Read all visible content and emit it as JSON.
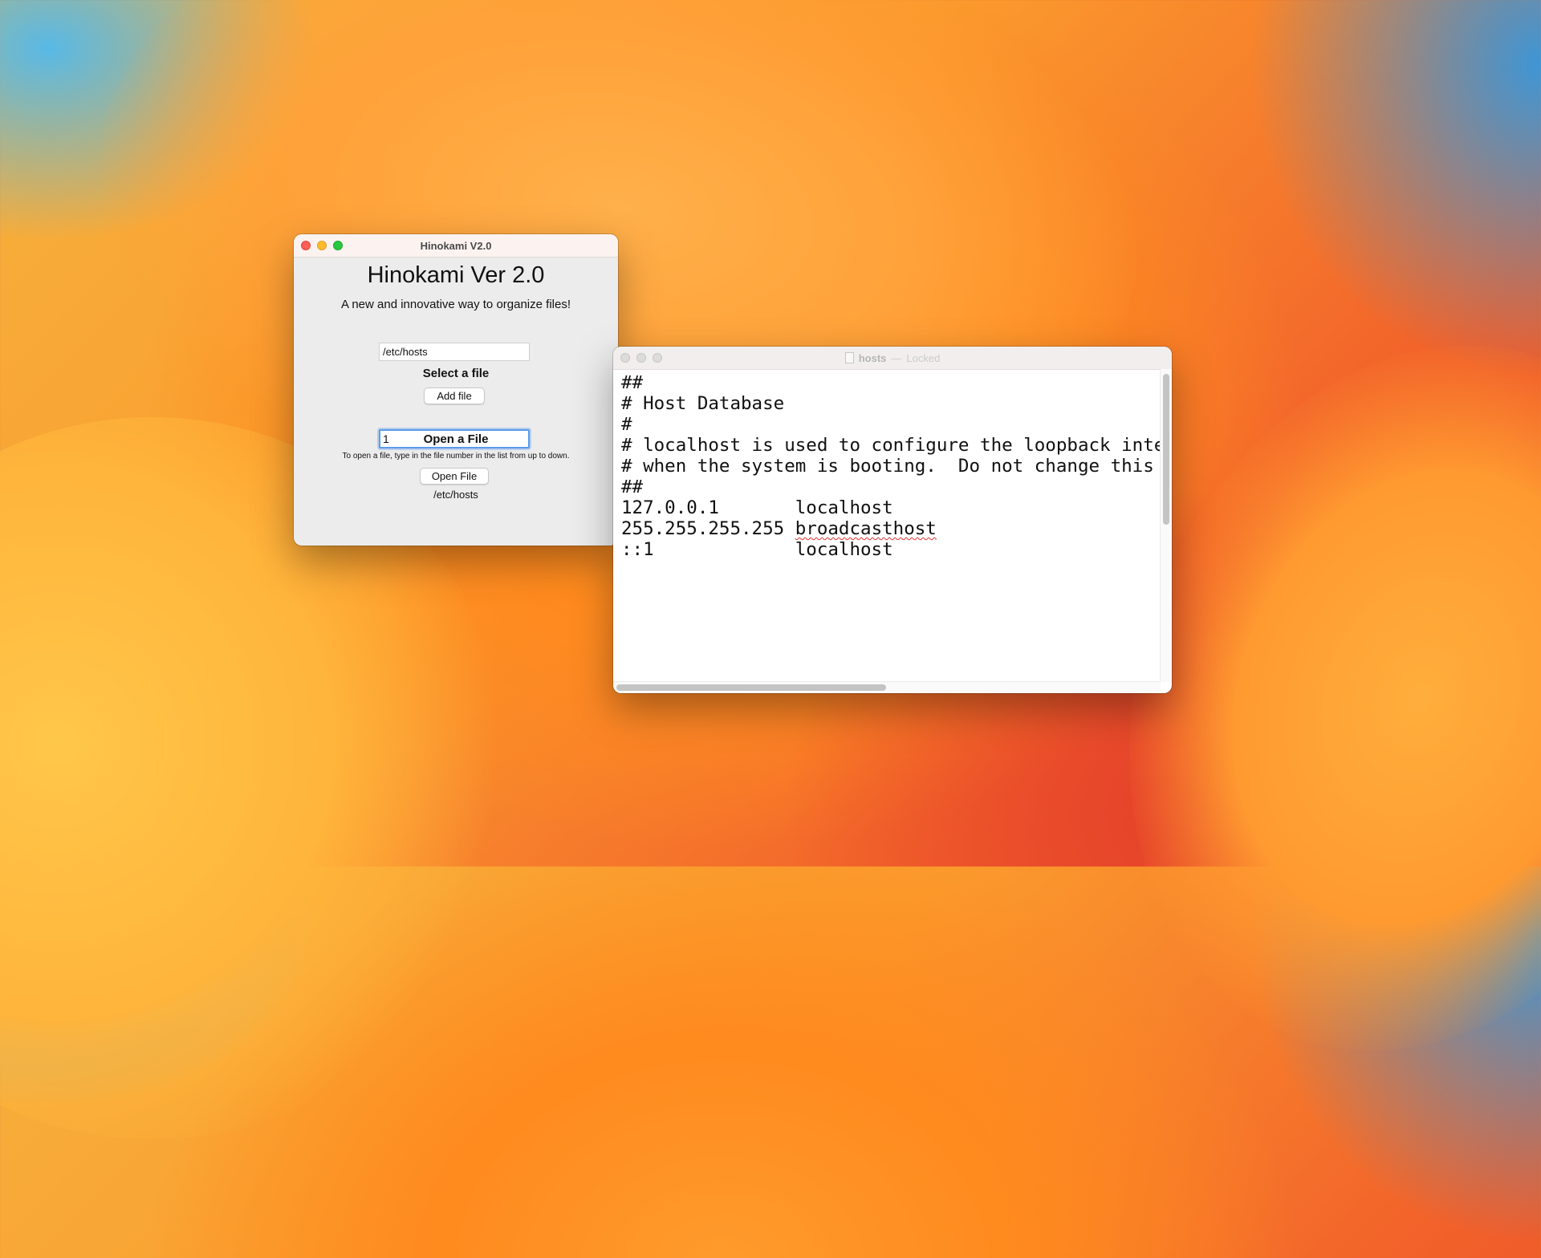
{
  "hinokami_window": {
    "title": "Hinokami V2.0",
    "heading": "Hinokami Ver 2.0",
    "subtitle": "A new and innovative way to organize files!",
    "path_field_value": "/etc/hosts",
    "select_label": "Select a file",
    "add_button": "Add file",
    "number_field_value": "1",
    "open_label": "Open a File",
    "hint": "To open a file, type in the file number in the list from up to down.",
    "open_button": "Open File",
    "opened_path": "/etc/hosts"
  },
  "textedit_window": {
    "title": "hosts",
    "separator": "—",
    "status": "Locked",
    "lines": [
      "##",
      "# Host Database",
      "#",
      "# localhost is used to configure the loopback interface",
      "# when the system is booting.  Do not change this entry.",
      "##",
      "127.0.0.1       localhost",
      "255.255.255.255 ",
      "::1             localhost"
    ],
    "misspelled_word": "broadcasthost"
  },
  "colors": {
    "traffic_red": "#fe5f57",
    "traffic_yellow": "#febc2e",
    "traffic_green": "#28c840",
    "focus_ring": "#5b9bea",
    "spell_underline": "#e03030"
  }
}
